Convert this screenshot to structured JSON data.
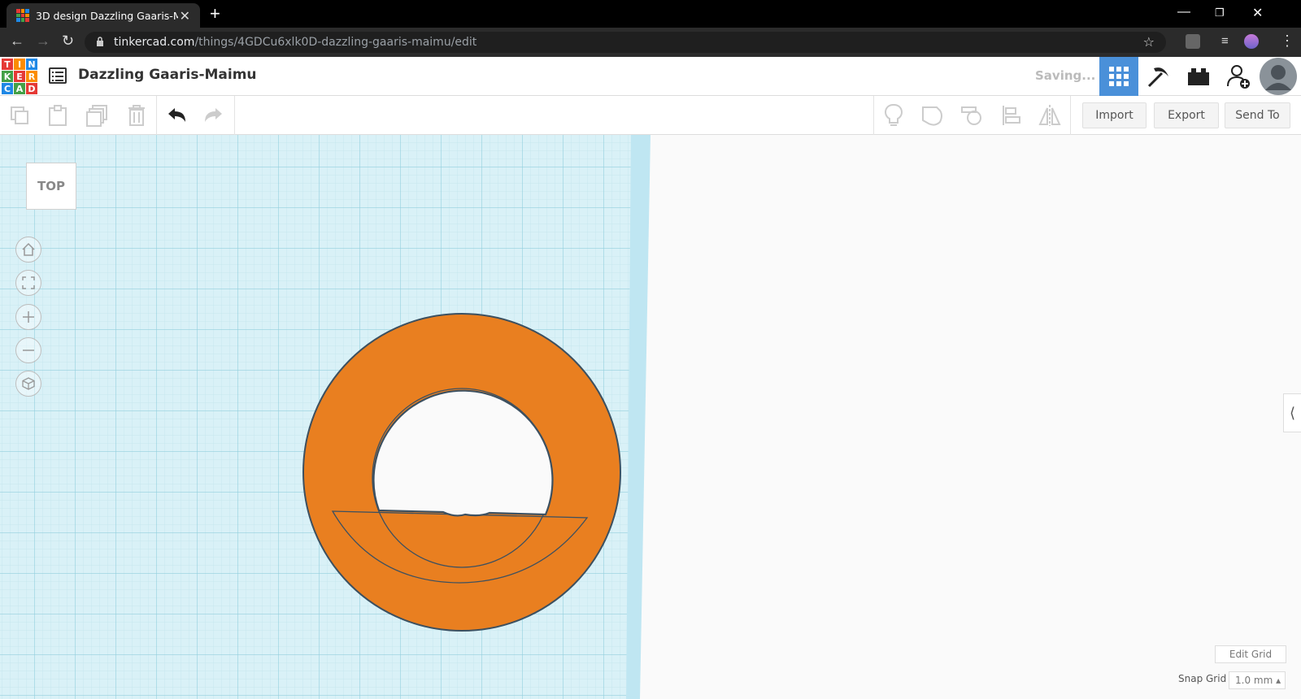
{
  "browser": {
    "tab_title": "3D design Dazzling Gaaris-Maimu",
    "url_host": "tinkercad.com",
    "url_path": "/things/4GDCu6xlk0D-dazzling-gaaris-maimu/edit"
  },
  "app": {
    "logo_letters": [
      "T",
      "I",
      "N",
      "K",
      "E",
      "R",
      "C",
      "A",
      "D"
    ],
    "design_title": "Dazzling Gaaris-Maimu",
    "status": "Saving..."
  },
  "toolbar": {
    "import_label": "Import",
    "export_label": "Export",
    "send_to_label": "Send To"
  },
  "workplane": {
    "view_label": "TOP",
    "edit_grid_label": "Edit Grid",
    "snap_grid_label": "Snap Grid",
    "snap_grid_value": "1.0 mm ▴"
  },
  "colors": {
    "shape_orange": "#e97f20",
    "grid_bg": "#d9f1f7",
    "grid_line": "#a6d6e2",
    "accent_blue": "#4a90d9"
  },
  "icons": [
    "copy-icon",
    "paste-icon",
    "duplicate-icon",
    "delete-icon",
    "undo-icon",
    "redo-icon",
    "note-icon",
    "solid-shape-icon",
    "hole-shape-icon",
    "align-icon",
    "mirror-icon",
    "grid-view-icon",
    "pickaxe-icon",
    "bricks-icon",
    "add-user-icon",
    "avatar",
    "home-view-icon",
    "fit-view-icon",
    "zoom-in-icon",
    "zoom-out-icon",
    "perspective-icon"
  ]
}
